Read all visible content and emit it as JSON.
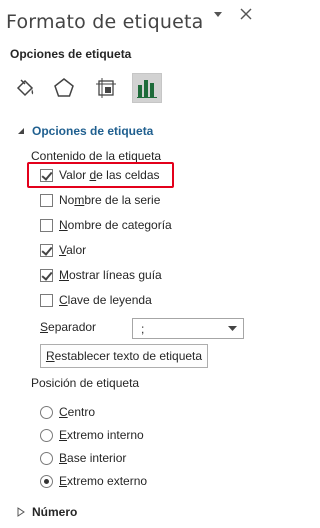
{
  "pane": {
    "title": "Formato de etiqueta",
    "subtitle": "Opciones de etiqueta"
  },
  "tabs": [
    {
      "icon": "paint-bucket-icon"
    },
    {
      "icon": "pentagon-icon"
    },
    {
      "icon": "size-properties-icon"
    },
    {
      "icon": "bar-chart-icon",
      "selected": true
    }
  ],
  "label_options": {
    "header": "Opciones de etiqueta",
    "contains_label": "Contenido de la etiqueta",
    "checkboxes": [
      {
        "pre": "Valor ",
        "key": "d",
        "post": "e las celdas",
        "checked": true
      },
      {
        "pre": "No",
        "key": "m",
        "post": "bre de la serie",
        "checked": false
      },
      {
        "pre": "",
        "key": "N",
        "post": "ombre de categoría",
        "checked": false
      },
      {
        "pre": "",
        "key": "V",
        "post": "alor",
        "checked": true
      },
      {
        "pre": "",
        "key": "M",
        "post": "ostrar líneas guía",
        "checked": true
      },
      {
        "pre": "",
        "key": "C",
        "post": "lave de leyenda",
        "checked": false
      }
    ],
    "separator": {
      "pre": "",
      "key": "S",
      "post": "eparador",
      "value": ";"
    },
    "reset_button": {
      "pre": "",
      "key": "R",
      "post": "establecer texto de etiqueta"
    },
    "position_label": "Posición de etiqueta",
    "positions": [
      {
        "pre": "",
        "key": "C",
        "post": "entro",
        "checked": false
      },
      {
        "pre": "",
        "key": "E",
        "post": "xtremo interno",
        "checked": false
      },
      {
        "pre": "",
        "key": "B",
        "post": "ase interior",
        "checked": false
      },
      {
        "pre": "",
        "key": "E",
        "post": "xtremo externo",
        "checked": true
      }
    ]
  },
  "number_section": {
    "header": "Número"
  },
  "colors": {
    "accent": "#1f5f8f",
    "highlight": "#e3001b"
  }
}
